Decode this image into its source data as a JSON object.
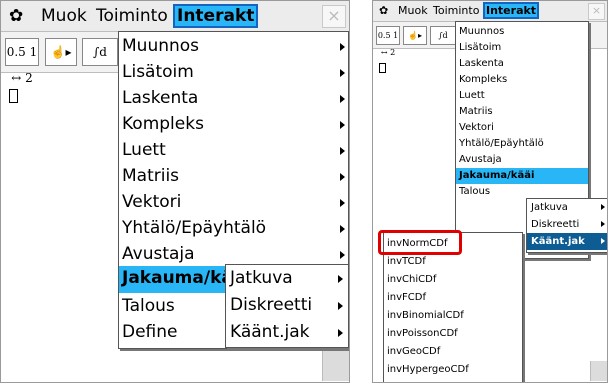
{
  "left": {
    "menubar": {
      "gear": "✿",
      "items": [
        "Muok",
        "Toiminto",
        "Interakt"
      ],
      "active": "Interakt",
      "close": "×"
    },
    "toolbar": {
      "btn1": "0.5 1 ↔ 2",
      "btn2": "☝▸",
      "btn3": "∫d"
    },
    "main_menu": [
      {
        "label": "Muunnos",
        "arrow": true
      },
      {
        "label": "Lisätoim",
        "arrow": true
      },
      {
        "label": "Laskenta",
        "arrow": true
      },
      {
        "label": "Kompleks",
        "arrow": true
      },
      {
        "label": "Luett",
        "arrow": true
      },
      {
        "label": "Matriis",
        "arrow": true
      },
      {
        "label": "Vektori",
        "arrow": true
      },
      {
        "label": "Yhtälö/Epäyhtälö",
        "arrow": true
      },
      {
        "label": "Avustaja",
        "arrow": true
      },
      {
        "label": "Jakauma/kääi",
        "arrow": false,
        "highlighted": true
      },
      {
        "label": "Talous",
        "arrow": false
      },
      {
        "label": "Define",
        "arrow": false
      }
    ],
    "sub_menu": [
      {
        "label": "Jatkuva",
        "arrow": true
      },
      {
        "label": "Diskreetti",
        "arrow": true
      },
      {
        "label": "Käänt.jak",
        "arrow": true
      }
    ]
  },
  "right": {
    "menubar": {
      "gear": "✿",
      "items": [
        "Muok",
        "Toiminto",
        "Interakt"
      ],
      "active": "Interakt",
      "close": "×"
    },
    "toolbar": {
      "btn1": "0.5 1 ↔ 2",
      "btn2": "☝▸",
      "btn3": "∫d"
    },
    "main_menu": [
      {
        "label": "Muunnos"
      },
      {
        "label": "Lisätoim"
      },
      {
        "label": "Laskenta"
      },
      {
        "label": "Kompleks"
      },
      {
        "label": "Luett"
      },
      {
        "label": "Matriis"
      },
      {
        "label": "Vektori"
      },
      {
        "label": "Yhtälö/Epäyhtälö"
      },
      {
        "label": "Avustaja"
      },
      {
        "label": "Jakauma/kääi",
        "highlighted": true
      },
      {
        "label": "Talous"
      }
    ],
    "sub_menu": [
      {
        "label": "Jatkuva",
        "arrow": true
      },
      {
        "label": "Diskreetti",
        "arrow": true
      },
      {
        "label": "Käänt.jak",
        "arrow": true,
        "highlighted": true
      }
    ],
    "inverse_menu": [
      "invNormCDf",
      "invTCDf",
      "invChiCDf",
      "invFCDf",
      "invBinomialCDf",
      "invPoissonCDf",
      "invGeoCDf",
      "invHypergeoCDf"
    ],
    "highlight_color": "#e00000"
  },
  "colors": {
    "accent": "#29b6f6",
    "selected_dark": "#0d5c93",
    "callout": "#e00000"
  }
}
